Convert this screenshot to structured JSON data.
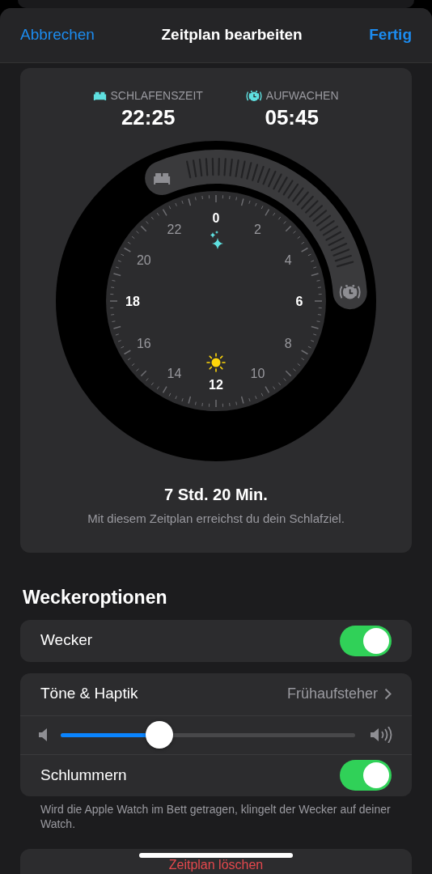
{
  "navigation": {
    "cancel": "Abbrechen",
    "title": "Zeitplan bearbeiten",
    "done": "Fertig"
  },
  "schedule": {
    "bedtime": {
      "label": "SCHLAFENSZEIT",
      "time": "22:25"
    },
    "wakeup": {
      "label": "AUFWACHEN",
      "time": "05:45"
    },
    "dial_labels": [
      {
        "text": "0",
        "emphasized": true
      },
      {
        "text": "2",
        "emphasized": false
      },
      {
        "text": "4",
        "emphasized": false
      },
      {
        "text": "6",
        "emphasized": true
      },
      {
        "text": "8",
        "emphasized": false
      },
      {
        "text": "10",
        "emphasized": false
      },
      {
        "text": "12",
        "emphasized": true
      },
      {
        "text": "14",
        "emphasized": false
      },
      {
        "text": "16",
        "emphasized": false
      },
      {
        "text": "18",
        "emphasized": true
      },
      {
        "text": "20",
        "emphasized": false
      },
      {
        "text": "22",
        "emphasized": false
      }
    ],
    "duration": "7 Std. 20 Min.",
    "note": "Mit diesem Zeitplan erreichst du dein Schlafziel."
  },
  "alarm_options": {
    "heading": "Weckeroptionen",
    "groups": [
      [
        {
          "kind": "toggle",
          "label": "Wecker",
          "on": true
        }
      ],
      [
        {
          "kind": "link",
          "label": "Töne & Haptik",
          "value": "Frühaufsteher"
        },
        {
          "kind": "slider",
          "level": 0.335
        },
        {
          "kind": "toggle",
          "label": "Schlummern",
          "on": true
        }
      ]
    ],
    "footer": "Wird die Apple Watch im Bett getragen, klingelt der Wecker auf deiner Watch."
  },
  "delete_button": "Zeitplan löschen"
}
